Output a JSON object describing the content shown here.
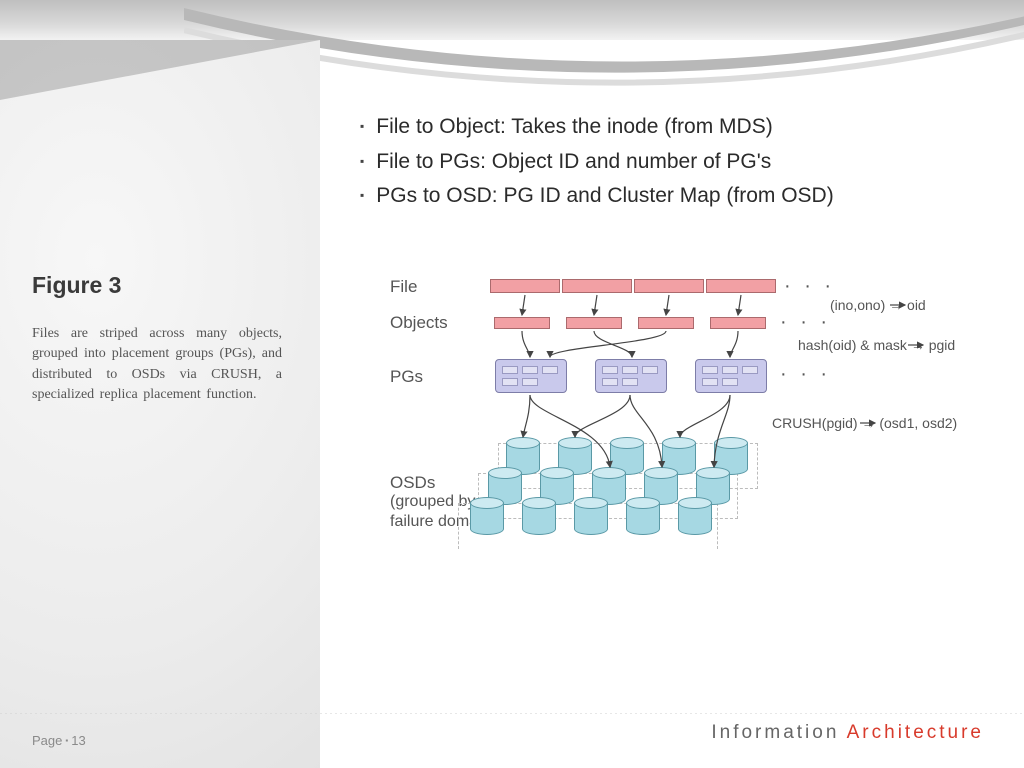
{
  "sidebar": {
    "figure_label": "Figure 3",
    "caption": "Files are striped across many objects, grouped into placement groups (PGs), and distributed to OSDs via CRUSH, a specialized replica placement function."
  },
  "page": {
    "label": "Page",
    "number": "13"
  },
  "bullets": [
    "File to Object: Takes the inode (from MDS)",
    "File to PGs: Object ID and number of PG's",
    "PGs to OSD: PG ID and Cluster Map (from OSD)"
  ],
  "diagram": {
    "row1": "File",
    "row2": "Objects",
    "row3": "PGs",
    "row4a": "OSDs",
    "row4b": "(grouped by",
    "row4c": " failure domain)",
    "f1": "(ino,ono) → oid",
    "f2": "hash(oid) & mask → pgid",
    "f3": "CRUSH(pgid) → (osd1, osd2)",
    "dots": "· · ·"
  },
  "footer": {
    "left": "Information",
    "right": "Architecture"
  }
}
